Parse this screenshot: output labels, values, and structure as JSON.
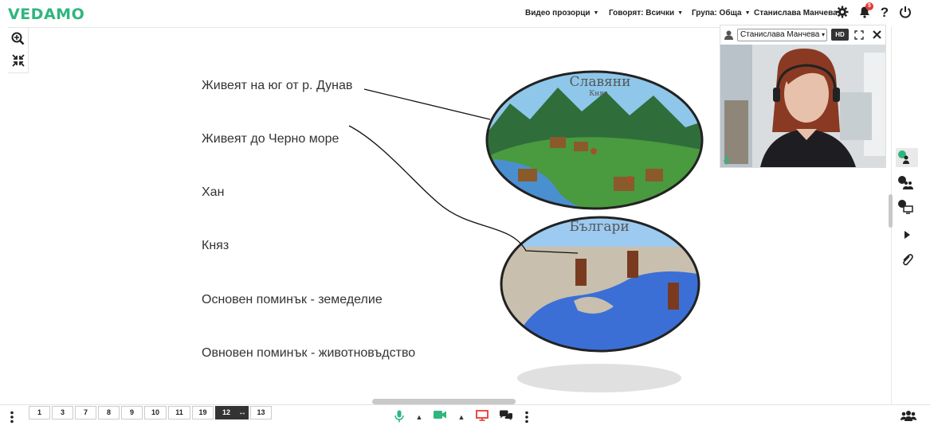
{
  "app": {
    "logo": "VEDAMO"
  },
  "topbar": {
    "video_windows": "Видео прозорци",
    "speaking": "Говорят: Всички",
    "group": "Група: Обща",
    "user_name": "Станислава Манчева",
    "notification_count": "5"
  },
  "board": {
    "lines": [
      "Живеят на юг от р. Дунав",
      "Живеят до Черно море",
      "Хан",
      "Княз",
      "Основен поминък - земеделие",
      "Овновен поминък - животновъдство"
    ],
    "image_slavs": {
      "title": "Славяни",
      "subtitle": "Княз"
    },
    "image_bulgars": {
      "title": "Българи"
    }
  },
  "video": {
    "selected_participant": "Станислава Манчева",
    "hd_label": "HD"
  },
  "pages": {
    "items": [
      "1",
      "3",
      "7",
      "8",
      "9",
      "10",
      "11",
      "19",
      "12",
      "13"
    ],
    "current": "12"
  },
  "colors": {
    "brand": "#2fb67e",
    "accent_red": "#e53935",
    "dark": "#333333"
  }
}
